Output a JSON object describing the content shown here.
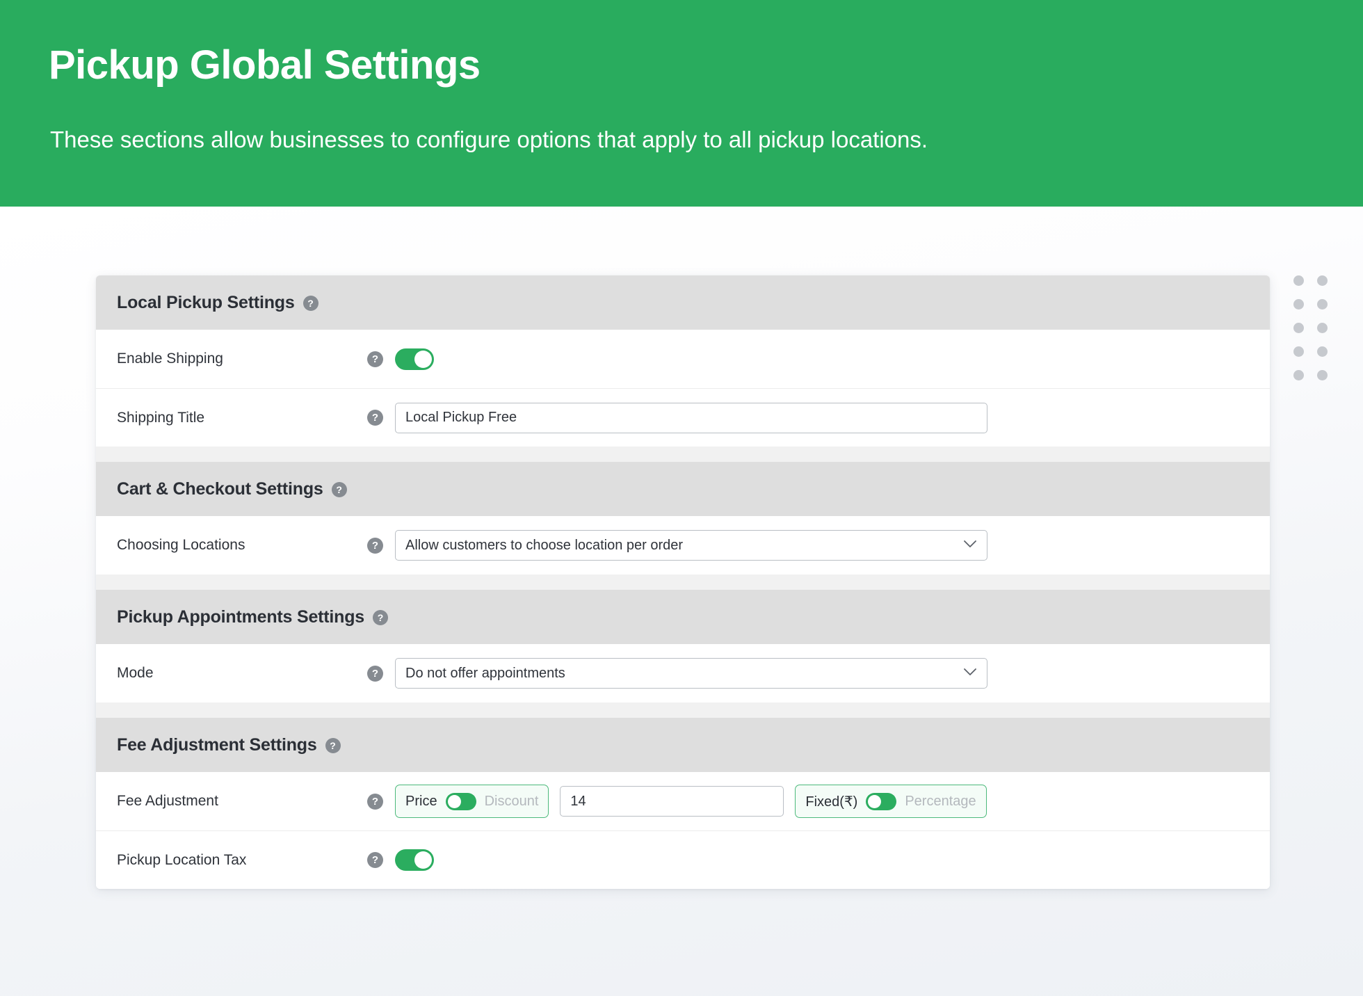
{
  "banner": {
    "title": "Pickup Global Settings",
    "subtitle": "These sections allow businesses to configure options that apply to all pickup locations.",
    "background_color": "#29ac5e",
    "text_color": "#ffffff"
  },
  "theme": {
    "accent_green": "#2bad5f",
    "section_header_bg": "#dedede",
    "card_gap_bg": "#f1f1f1",
    "row_bg": "#ffffff",
    "dot_color": "#c6c9ce",
    "border_gray": "#b9bec4"
  },
  "help_icon_glyph": "?",
  "chevron_icon_name": "chevron-down-icon",
  "sections": [
    {
      "id": "local-pickup-settings",
      "title": "Local Pickup Settings",
      "has_help": true,
      "rows": [
        {
          "id": "enable-shipping",
          "label": "Enable Shipping",
          "control": "toggle",
          "toggle_state": "on"
        },
        {
          "id": "shipping-title",
          "label": "Shipping Title",
          "control": "text",
          "value": "Local Pickup Free",
          "placeholder": "Shipping Title"
        }
      ]
    },
    {
      "id": "cart-checkout-settings",
      "title": "Cart & Checkout Settings",
      "has_help": true,
      "rows": [
        {
          "id": "choosing-locations",
          "label": "Choosing Locations",
          "control": "select",
          "value": "Allow customers to choose location per order"
        }
      ]
    },
    {
      "id": "pickup-appointments-settings",
      "title": "Pickup Appointments Settings",
      "has_help": true,
      "rows": [
        {
          "id": "mode",
          "label": "Mode",
          "control": "select",
          "value": "Do not offer appointments"
        }
      ]
    },
    {
      "id": "fee-adjustment-settings",
      "title": "Fee Adjustment Settings",
      "has_help": true,
      "rows": [
        {
          "id": "fee-adjustment",
          "label": "Fee Adjustment",
          "control": "fee-group",
          "type_toggle": {
            "left_label": "Price",
            "right_label": "Discount",
            "selected": "Price",
            "knob_side": "left"
          },
          "amount_value": "14",
          "amount_placeholder": "",
          "unit_toggle": {
            "left_label": "Fixed(₹)",
            "right_label": "Percentage",
            "selected": "Fixed(₹)",
            "knob_side": "left"
          }
        },
        {
          "id": "pickup-location-tax",
          "label": "Pickup Location Tax",
          "control": "toggle",
          "toggle_state": "on"
        }
      ]
    }
  ],
  "decoration": {
    "dot_grid_columns": 2,
    "dot_grid_rows": 5
  }
}
